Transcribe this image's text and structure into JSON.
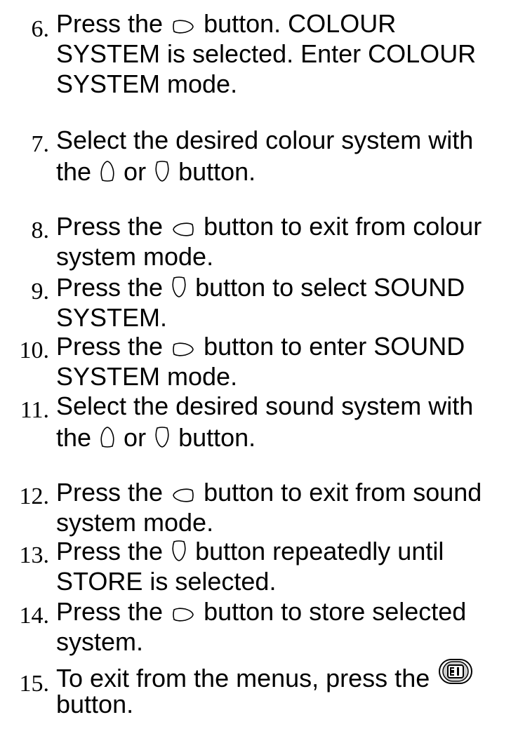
{
  "steps": [
    {
      "num": "6.",
      "lines": [
        [
          "Press the ",
          "@right",
          " button. COLOUR"
        ],
        [
          "SYSTEM is selected. Enter COLOUR"
        ],
        [
          "SYSTEM mode."
        ]
      ]
    },
    {
      "num": "7.",
      "lines": [
        [
          "Select the desired colour system with"
        ],
        [
          "the ",
          "@up",
          " or ",
          "@down",
          " button."
        ]
      ]
    },
    {
      "num": "8.",
      "lines": [
        [
          "Press the ",
          "@left",
          " button to exit from colour"
        ],
        [
          "system mode."
        ]
      ]
    },
    {
      "num": "9.",
      "lines": [
        [
          "Press the ",
          "@down",
          " button to select SOUND"
        ],
        [
          "SYSTEM."
        ]
      ]
    },
    {
      "num": "10.",
      "lines": [
        [
          "Press the ",
          "@right",
          " button to enter SOUND"
        ],
        [
          "SYSTEM mode."
        ]
      ]
    },
    {
      "num": "11.",
      "lines": [
        [
          "Select the desired sound system with"
        ],
        [
          "the ",
          "@up",
          " or ",
          "@down",
          " button."
        ]
      ]
    },
    {
      "num": "12.",
      "lines": [
        [
          "Press the ",
          "@left",
          " button to exit from sound"
        ],
        [
          "system mode."
        ]
      ]
    },
    {
      "num": "13.",
      "lines": [
        [
          "Press the ",
          "@down",
          " button repeatedly until"
        ],
        [
          "STORE is selected."
        ]
      ]
    },
    {
      "num": "14.",
      "lines": [
        [
          "Press the ",
          "@right",
          " button to store selected"
        ],
        [
          "system."
        ]
      ]
    },
    {
      "num": "15.",
      "lines": [
        [
          "To exit from the menus, press the ",
          "@menu"
        ],
        [
          "button."
        ]
      ]
    }
  ],
  "icons": {
    "@right": "cursor-right-button-icon",
    "@left": "cursor-left-button-icon",
    "@up": "cursor-up-button-icon",
    "@down": "cursor-down-button-icon",
    "@menu": "menu-button-icon"
  }
}
